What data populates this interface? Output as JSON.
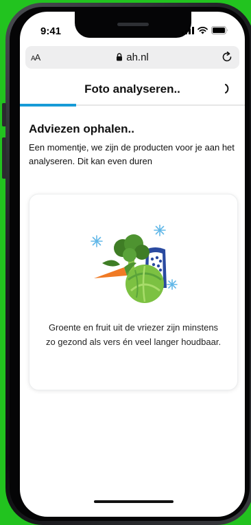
{
  "status_bar": {
    "time": "9:41"
  },
  "browser": {
    "text_size_label": "AA",
    "url": "ah.nl"
  },
  "header": {
    "title": "Foto analyseren..",
    "progress": 0.25
  },
  "content": {
    "heading": "Adviezen ophalen..",
    "subtext": "Een momentje, we zijn de producten voor je aan het analyseren. Dit kan even duren"
  },
  "card": {
    "tip": "Groente en fruit uit de vriezer zijn minstens zo gezond als vers én veel langer houdbaar.",
    "illustration_icon": "frozen-vegetables-icon"
  },
  "colors": {
    "background": "#22c31f",
    "accent": "#179bd7"
  }
}
